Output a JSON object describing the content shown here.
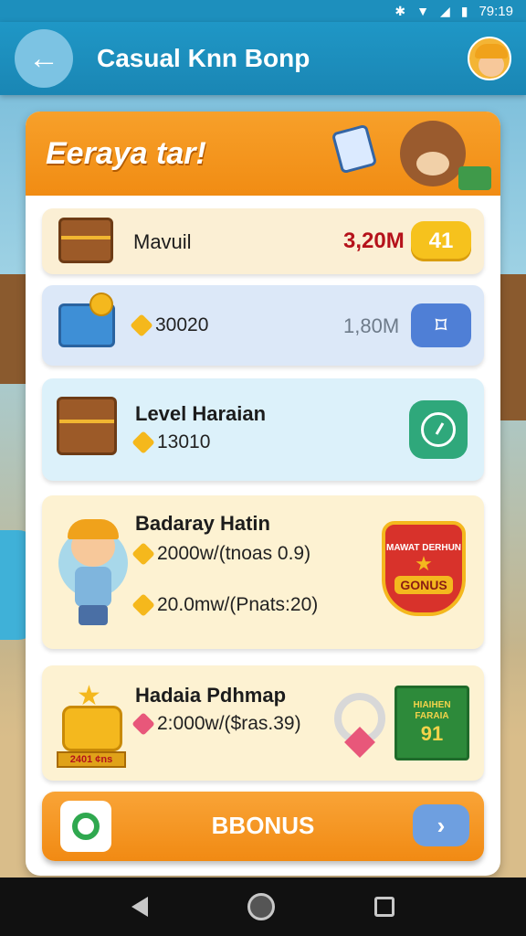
{
  "status_bar": {
    "time": "79:19"
  },
  "app_bar": {
    "back_icon": "arrow-left-icon",
    "title": "Casual Knn Bonp"
  },
  "panel": {
    "header_title": "Eeraya tar!",
    "rows": [
      {
        "label": "Mavuil",
        "amount": "3,20M",
        "button": "41"
      },
      {
        "sub": "30020",
        "amount": "1,80M",
        "button": "⌑"
      },
      {
        "label": "Level Haraian",
        "sub": "13010"
      },
      {
        "label": "Badaray Hatin",
        "sub1": "2000w/(tnoas 0.9)",
        "sub2": "20.0mw/(Pnats:20)",
        "badge_top": "MAWAT DERHUN",
        "badge_bottom": "GONUS"
      },
      {
        "label": "Hadaia Pdhmap",
        "sub": "2:000w/($ras.39)",
        "coins_plate": "2401 ¢ns",
        "ticket_top": "HIAIHEN FARAIA",
        "ticket_number": "91"
      }
    ],
    "bonus_button": "BBONUS"
  },
  "colors": {
    "accent": "#f18c13",
    "appbar": "#1a86b4",
    "danger": "#b5121b"
  }
}
